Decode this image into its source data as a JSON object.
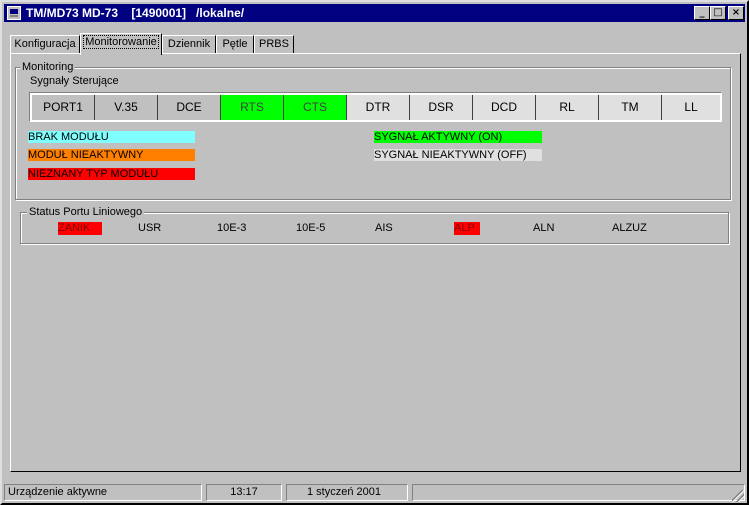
{
  "window": {
    "title": "TM/MD73 MD-73    [1490001]   /lokalne/",
    "minimize_glyph": "_",
    "maximize_glyph": "□",
    "close_glyph": "×"
  },
  "tabs": [
    {
      "label": "Konfiguracja",
      "active": false
    },
    {
      "label": "Monitorowanie",
      "active": true
    },
    {
      "label": "Dziennik",
      "active": false
    },
    {
      "label": "Pętle",
      "active": false
    },
    {
      "label": "PRBS",
      "active": false
    }
  ],
  "monitoring": {
    "group_label": "Monitoring",
    "signals_label": "Sygnały Sterujące",
    "signals": [
      {
        "label": "PORT1",
        "state": "inactive"
      },
      {
        "label": "V.35",
        "state": "inactive"
      },
      {
        "label": "DCE",
        "state": "inactive"
      },
      {
        "label": "RTS",
        "state": "active"
      },
      {
        "label": "CTS",
        "state": "active"
      },
      {
        "label": "DTR",
        "state": "off"
      },
      {
        "label": "DSR",
        "state": "off"
      },
      {
        "label": "DCD",
        "state": "off"
      },
      {
        "label": "RL",
        "state": "off"
      },
      {
        "label": "TM",
        "state": "off"
      },
      {
        "label": "LL",
        "state": "off"
      }
    ],
    "legend": [
      {
        "label": "BRAK MODUŁU",
        "color": "#80ffff"
      },
      {
        "label": "MODUŁ NIEAKTYWNY",
        "color": "#ff8000"
      },
      {
        "label": "NIEZNANY TYP MODUŁU",
        "color": "#ff0000"
      },
      {
        "label": "SYGNAŁ AKTYWNY (ON)",
        "color": "#00ff00"
      },
      {
        "label": "SYGNAŁ NIEAKTYWNY (OFF)",
        "color": "#e0e0e0"
      }
    ]
  },
  "port_status": {
    "label": "Status Portu Liniowego",
    "items": [
      {
        "label": "ZANIK",
        "alarm": true
      },
      {
        "label": "USR",
        "alarm": false
      },
      {
        "label": "10E-3",
        "alarm": false
      },
      {
        "label": "10E-5",
        "alarm": false
      },
      {
        "label": "AIS",
        "alarm": false
      },
      {
        "label": "ALP",
        "alarm": true
      },
      {
        "label": "ALN",
        "alarm": false
      },
      {
        "label": "ALZUZ",
        "alarm": false
      }
    ]
  },
  "statusbar": {
    "status": "Urządzenie aktywne",
    "time": "13:17",
    "date": "1 styczeń 2001"
  },
  "colors": {
    "signal_inactive": "#c0c0c0",
    "signal_active": "#00ff00",
    "signal_off": "#e0e0e0",
    "alarm": "#ff0000"
  }
}
